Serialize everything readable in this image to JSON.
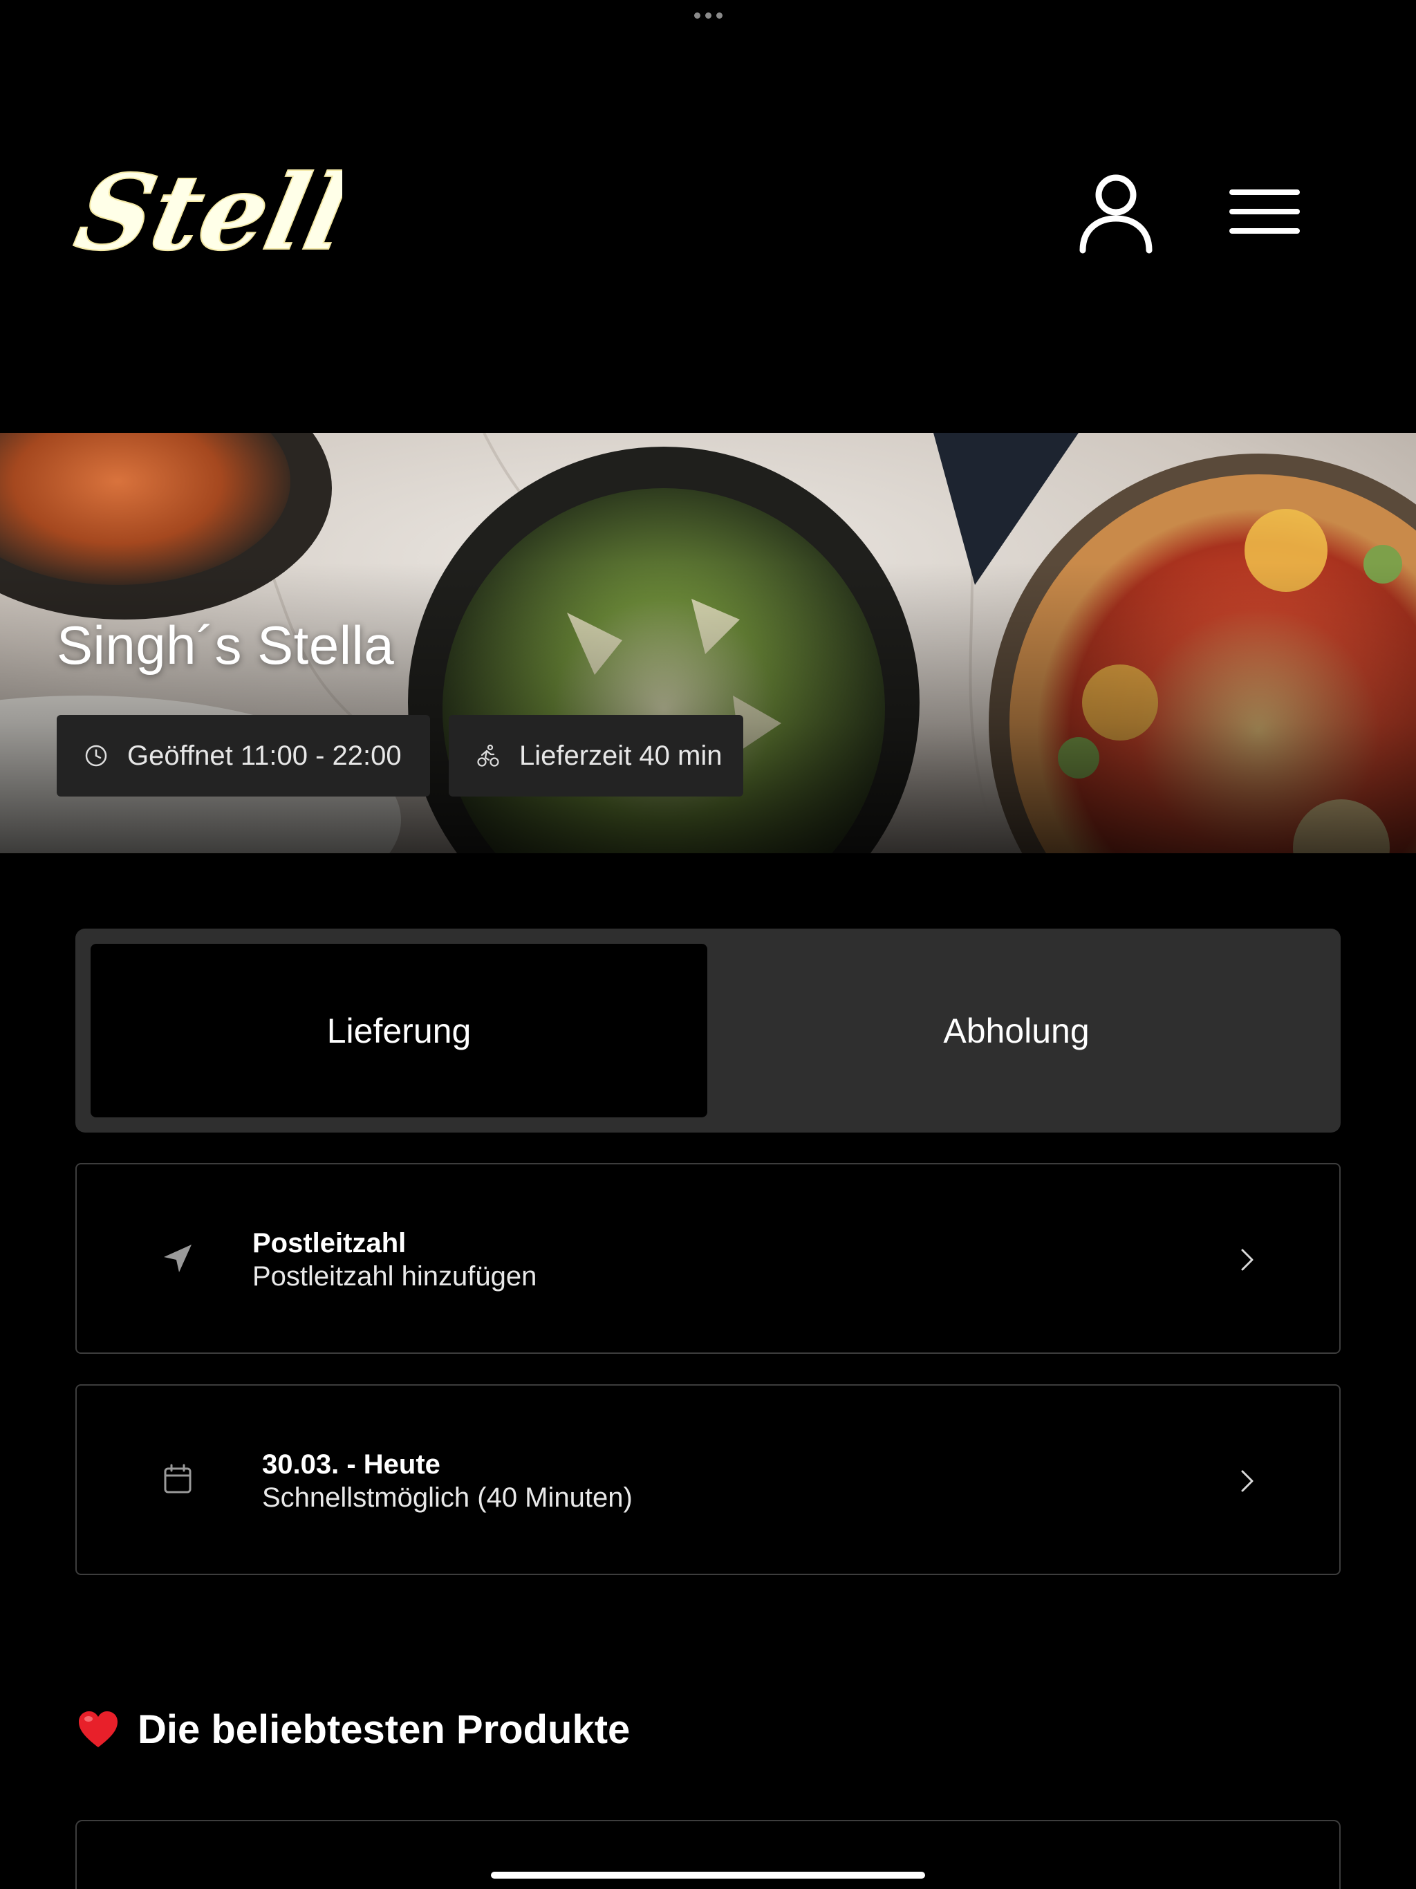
{
  "app": {
    "brand": "Stella",
    "accent_color": "#ffffe0",
    "background_color": "#000000"
  },
  "header": {
    "profile_icon": "user-icon",
    "menu_icon": "hamburger-menu-icon"
  },
  "hero": {
    "title": "Singh´s Stella",
    "opening_hours": "Geöffnet 11:00 - 22:00",
    "opening_icon": "clock-icon",
    "delivery_time": "Lieferzeit 40 min",
    "delivery_icon": "cyclist-icon"
  },
  "order_mode": {
    "options": [
      "Lieferung",
      "Abholung"
    ],
    "selected": "Lieferung"
  },
  "postcode_row": {
    "icon": "location-arrow-icon",
    "title": "Postleitzahl",
    "subtitle": "Postleitzahl hinzufügen"
  },
  "date_row": {
    "icon": "calendar-icon",
    "title": "30.03. - Heute",
    "subtitle": "Schnellstmöglich (40 Minuten)"
  },
  "popular": {
    "icon": "heart-icon",
    "title": "Die beliebtesten Produkte"
  }
}
